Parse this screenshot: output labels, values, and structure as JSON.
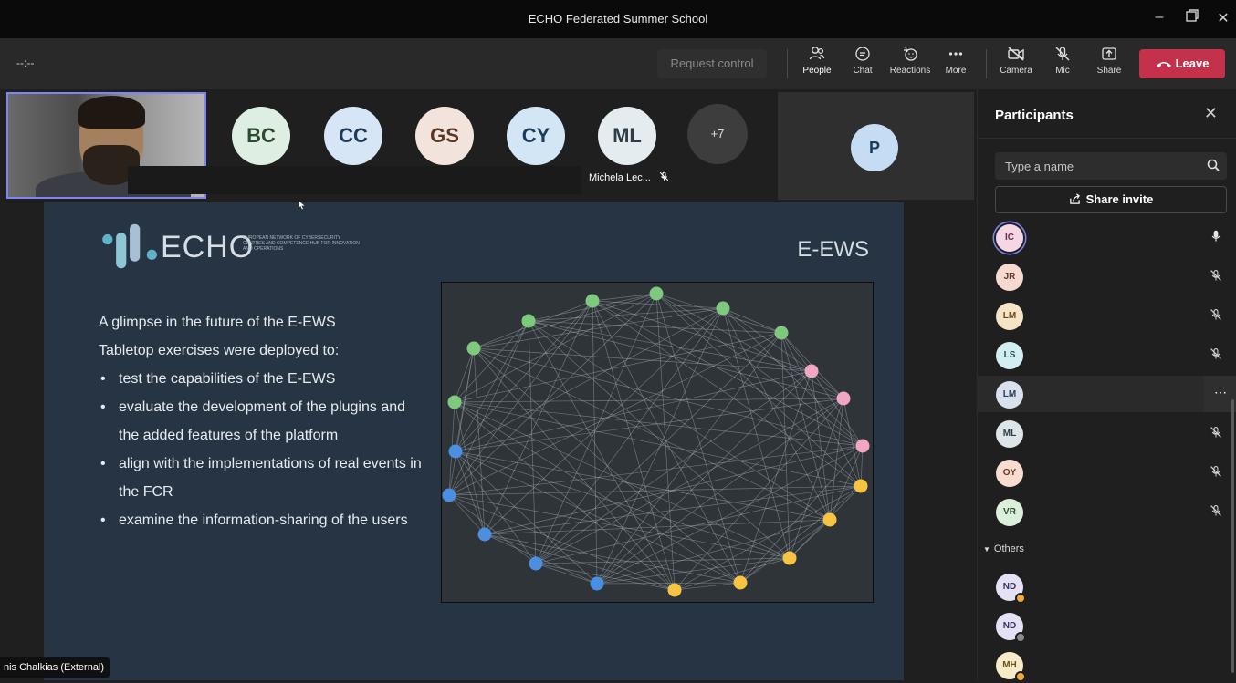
{
  "window": {
    "title": "ECHO Federated Summer School"
  },
  "toolbar": {
    "timer": "--:--",
    "request_control": "Request control",
    "people": "People",
    "chat": "Chat",
    "reactions": "Reactions",
    "more": "More",
    "camera": "Camera",
    "mic": "Mic",
    "share": "Share",
    "leave": "Leave"
  },
  "gallery": {
    "avatars": [
      {
        "initials": "BC",
        "bg": "#dfeee2",
        "fg": "#2d4a33"
      },
      {
        "initials": "CC",
        "bg": "#d7e6f6",
        "fg": "#1f3b58"
      },
      {
        "initials": "GS",
        "bg": "#f2e4dc",
        "fg": "#5a3626"
      },
      {
        "initials": "CY",
        "bg": "#d3e6f6",
        "fg": "#1d3b5a"
      },
      {
        "initials": "ML",
        "bg": "#e4ecef",
        "fg": "#2e3d45"
      }
    ],
    "overflow": "+7",
    "speaker_name": "Michela Lec...",
    "pinned_initial": "P"
  },
  "slide": {
    "logo_text": "ECHO",
    "logo_subtext": "EUROPEAN NETWORK OF CYBERSECURITY CENTRES AND COMPETENCE HUB FOR INNOVATION AND OPERATIONS",
    "heading": "E-EWS",
    "intro1": "A glimpse in the future of the E-EWS",
    "intro2": "Tabletop exercises were deployed  to:",
    "bullets": [
      "test the capabilities of the E-EWS",
      "evaluate the development of the plugins and the added features of the platform",
      "align with the implementations of real events in the FCR",
      "examine the information-sharing of the users"
    ],
    "node_colors": {
      "green": "#7fc97f",
      "pink": "#f1a7c4",
      "yellow": "#f6c342",
      "blue": "#4a8fe0"
    }
  },
  "panel": {
    "title": "Participants",
    "search_placeholder": "Type a name",
    "share_invite": "Share invite",
    "participants": [
      {
        "initials": "IC",
        "bg": "#f5d6e4",
        "fg": "#6a2e49",
        "mic": "on"
      },
      {
        "initials": "JR",
        "bg": "#f6d9cf",
        "fg": "#6a3527",
        "mic": "muted"
      },
      {
        "initials": "LM",
        "bg": "#f6e4c7",
        "fg": "#6a4a1a",
        "mic": "muted"
      },
      {
        "initials": "LS",
        "bg": "#d3eef0",
        "fg": "#1f4f55",
        "mic": "muted"
      },
      {
        "initials": "LM",
        "bg": "#d9e1ee",
        "fg": "#2d3d58",
        "mic": "more"
      },
      {
        "initials": "ML",
        "bg": "#dde5e9",
        "fg": "#2e3d45",
        "mic": "muted"
      },
      {
        "initials": "OY",
        "bg": "#f7dccf",
        "fg": "#6a3527",
        "mic": "muted"
      },
      {
        "initials": "VR",
        "bg": "#dcefdc",
        "fg": "#2d4a33",
        "mic": "muted"
      }
    ],
    "others_label": "Others",
    "others": [
      {
        "initials": "ND",
        "bg": "#e4e1f4",
        "fg": "#3a3360",
        "badge": "#f2a83a"
      },
      {
        "initials": "ND",
        "bg": "#e4e1f4",
        "fg": "#3a3360",
        "badge": "#8a8a8a"
      },
      {
        "initials": "MH",
        "bg": "#f6ebc8",
        "fg": "#6a551a",
        "badge": "#f2a83a"
      }
    ]
  },
  "caption": {
    "name": "nis Chalkias (External)"
  }
}
